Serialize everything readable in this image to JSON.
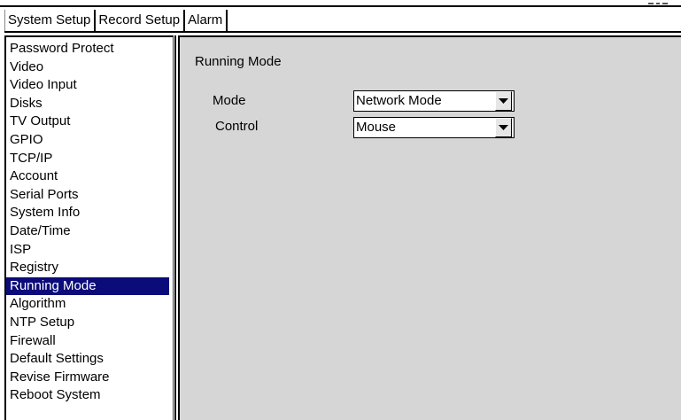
{
  "tabs": [
    {
      "label": "System Setup"
    },
    {
      "label": "Record Setup"
    },
    {
      "label": "Alarm"
    }
  ],
  "sidebar": {
    "selected": "Running Mode",
    "items": [
      {
        "label": "Password Protect"
      },
      {
        "label": "Video"
      },
      {
        "label": "Video Input"
      },
      {
        "label": "Disks"
      },
      {
        "label": "TV Output"
      },
      {
        "label": "GPIO"
      },
      {
        "label": "TCP/IP"
      },
      {
        "label": "Account"
      },
      {
        "label": "Serial Ports"
      },
      {
        "label": "System Info"
      },
      {
        "label": "Date/Time"
      },
      {
        "label": "ISP"
      },
      {
        "label": "Registry"
      },
      {
        "label": "Running Mode"
      },
      {
        "label": "Algorithm"
      },
      {
        "label": "NTP Setup"
      },
      {
        "label": "Firewall"
      },
      {
        "label": "Default Settings"
      },
      {
        "label": "Revise Firmware"
      },
      {
        "label": "Reboot System"
      }
    ]
  },
  "main": {
    "title": "Running Mode",
    "mode": {
      "label": "Mode",
      "value": "Network Mode",
      "icon": "chevron-down-icon"
    },
    "control": {
      "label": "Control",
      "value": "Mouse",
      "icon": "chevron-down-icon"
    }
  },
  "colors": {
    "selection": "#0b0b7a",
    "panel": "#d6d6d6"
  }
}
